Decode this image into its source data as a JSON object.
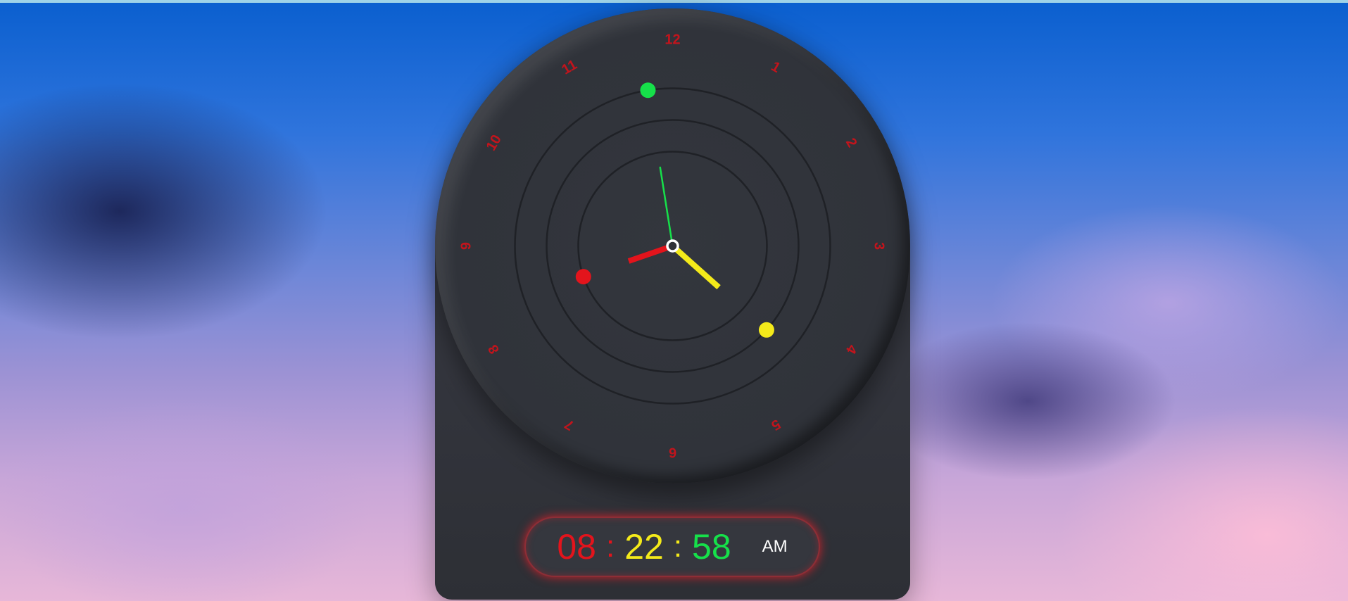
{
  "clock": {
    "hour_numbers": [
      "12",
      "1",
      "2",
      "3",
      "4",
      "5",
      "6",
      "7",
      "8",
      "9",
      "10",
      "11"
    ],
    "time": {
      "hours": "08",
      "minutes": "22",
      "seconds": "58",
      "period": "AM"
    },
    "separator": ":",
    "colors": {
      "hours": "#e3141c",
      "minutes": "#f4ea1a",
      "seconds": "#16e04a",
      "numerals": "#c2141c",
      "rings": "#1f2126"
    },
    "hand_angles_deg": {
      "hour": 251,
      "minute": 131.8,
      "second": -9
    },
    "orbit_dot_angles_deg": {
      "hour": 251,
      "minute": 131.8,
      "second": -9
    }
  }
}
